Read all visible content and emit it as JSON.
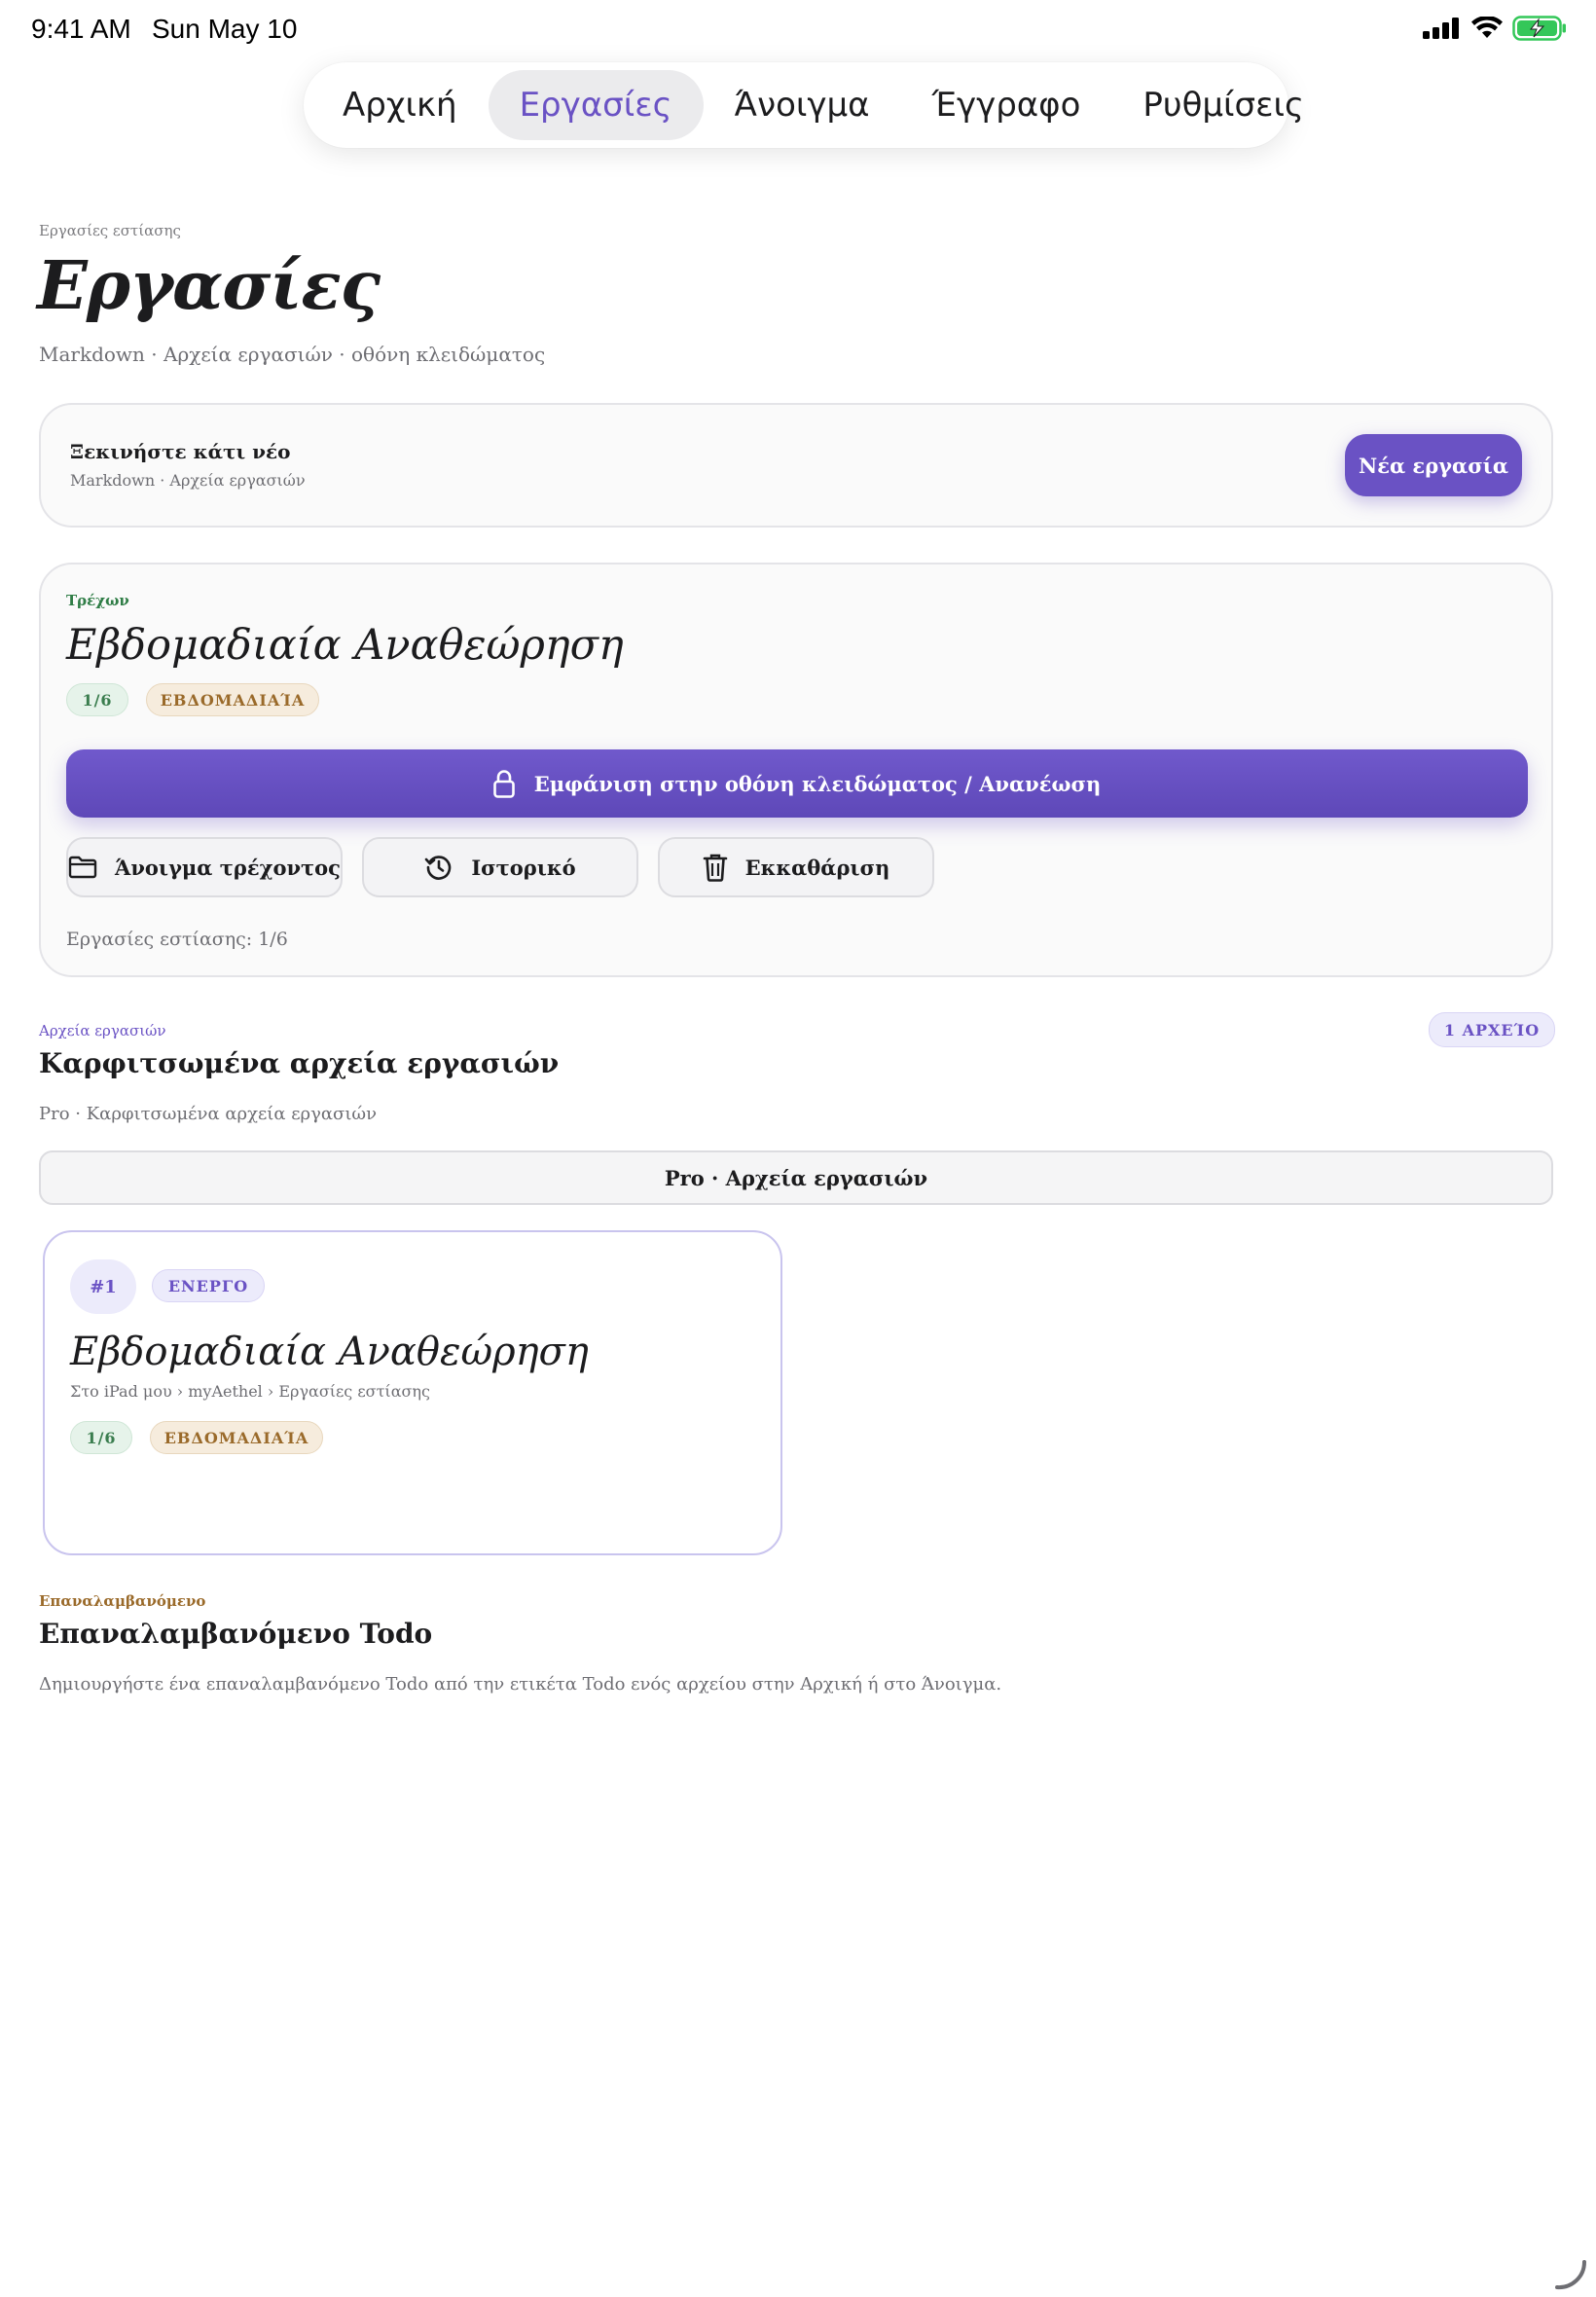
{
  "status_bar": {
    "time": "9:41 AM",
    "date": "Sun May 10"
  },
  "tabs": [
    {
      "label": "Αρχική",
      "active": false
    },
    {
      "label": "Εργασίες",
      "active": true
    },
    {
      "label": "Άνοιγμα",
      "active": false
    },
    {
      "label": "Έγγραφο",
      "active": false
    },
    {
      "label": "Ρυθμίσεις",
      "active": false
    }
  ],
  "page": {
    "eyebrow": "Εργασίες εστίασης",
    "title": "Εργασίες",
    "subtitle": "Markdown · Αρχεία εργασιών · οθόνη κλειδώματος"
  },
  "start_card": {
    "title": "Ξεκινήστε κάτι νέο",
    "subtitle": "Markdown · Αρχεία εργασιών",
    "button": "Νέα εργασία"
  },
  "current_card": {
    "label": "Τρέχων",
    "title": "Εβδομαδιαία Αναθεώρηση",
    "progress_badge": "1/6",
    "period_badge": "ΕΒΔΟΜΑΔΙΑΊΑ",
    "lock_button": "Εμφάνιση στην οθόνη κλειδώματος / Ανανέωση",
    "open_button": "Άνοιγμα τρέχοντος",
    "history_button": "Ιστορικό",
    "clear_button": "Εκκαθάριση",
    "focus_count": "Εργασίες εστίασης: 1/6"
  },
  "pinned": {
    "eyebrow": "Αρχεία εργασιών",
    "count_badge": "1 ΑΡΧΕΊΟ",
    "title": "Καρφιτσωμένα αρχεία εργασιών",
    "subtitle": "Pro · Καρφιτσωμένα αρχεία εργασιών",
    "pro_bar": "Pro · Αρχεία εργασιών",
    "files": [
      {
        "index": "#1",
        "status": "ΕΝΕΡΓΟ",
        "title": "Εβδομαδιαία Αναθεώρηση",
        "path": "Στο iPad μου › myAethel › Εργασίες εστίασης",
        "progress": "1/6",
        "period": "ΕΒΔΟΜΑΔΙΑΊΑ"
      }
    ]
  },
  "recurring": {
    "eyebrow": "Επαναλαμβανόμενο",
    "title": "Επαναλαμβανόμενο Todo",
    "description": "Δημιουργήστε ένα επαναλαμβανόμενο Todo από την ετικέτα Todo ενός αρχείου στην Αρχική ή στο Άνοιγμα."
  },
  "colors": {
    "accent": "#6a52c4",
    "green": "#3a7d4e",
    "tan": "#9a6a2a",
    "battery": "#34c759"
  },
  "icons": [
    "signal-icon",
    "wifi-icon",
    "battery-charging-icon",
    "lock-icon",
    "folder-icon",
    "history-icon",
    "trash-icon"
  ]
}
